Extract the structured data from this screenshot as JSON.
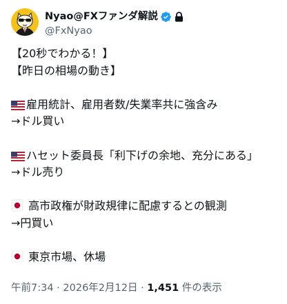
{
  "author": {
    "display_name": "Nyao@FXファンダ解説",
    "handle": "@FxNyao",
    "verified_icon": "verified-badge-icon",
    "protected_icon": "lock-icon",
    "colors": {
      "verified": "#1d9bf0",
      "avatar_bg": "#f4c21a"
    }
  },
  "tweet": {
    "lines": [
      "【20秒でわかる！】",
      "【昨日の相場の動き】",
      "",
      {
        "flag": "us",
        "text": "雇用統計、雇用者数/失業率共に強含み"
      },
      "→ドル買い",
      "",
      {
        "flag": "us",
        "text": "ハセット委員長「利下げの余地、充分にある」"
      },
      "→ドル売り",
      "",
      {
        "flag": "jp",
        "text": " 高市政権が財政規律に配慮するとの観測"
      },
      "→円買い",
      "",
      {
        "flag": "jp",
        "text": " 東京市場、休場"
      }
    ]
  },
  "meta": {
    "time": "午前7:34",
    "separator": " · ",
    "date": "2026年2月12日",
    "views_count": "1,451",
    "views_label": " 件の表示"
  }
}
